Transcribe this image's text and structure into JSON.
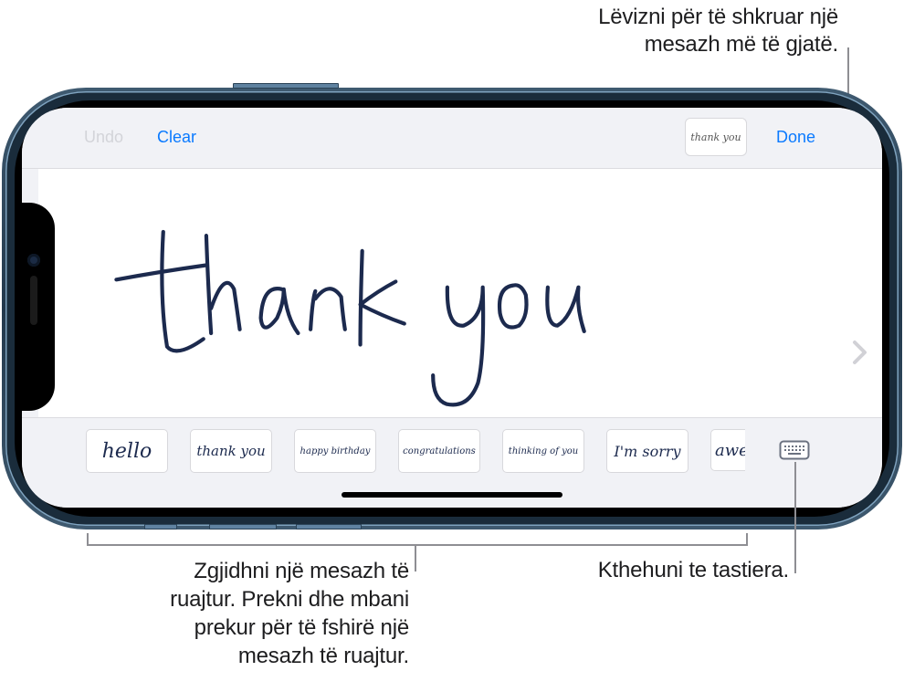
{
  "callouts": {
    "scroll": [
      "Lëvizni për të shkruar një",
      "mesazh më të gjatë."
    ],
    "saved": [
      "Zgjidhni një mesazh të",
      "ruajtur. Prekni dhe mbani",
      "prekur për të fshirë një",
      "mesazh të ruajtur."
    ],
    "keyboard": [
      "Kthehuni te tastiera."
    ]
  },
  "toolbar": {
    "undo_label": "Undo",
    "clear_label": "Clear",
    "done_label": "Done",
    "recent_thumbnail_text": "thank you"
  },
  "canvas": {
    "handwritten_text": "thank you",
    "scroll_icon": "chevron-right-icon"
  },
  "saved_messages": [
    {
      "text": "hello"
    },
    {
      "text": "thank you"
    },
    {
      "text": "happy birthday"
    },
    {
      "text": "congratulations"
    },
    {
      "text": "thinking of you"
    },
    {
      "text": "I'm sorry"
    },
    {
      "text": "awe"
    }
  ],
  "keyboard_button": {
    "icon": "keyboard-icon"
  },
  "colors": {
    "accent": "#0a7aff",
    "ink": "#1c2a4e",
    "disabled": "#d3d4d9",
    "background": "#f1f2f6"
  }
}
